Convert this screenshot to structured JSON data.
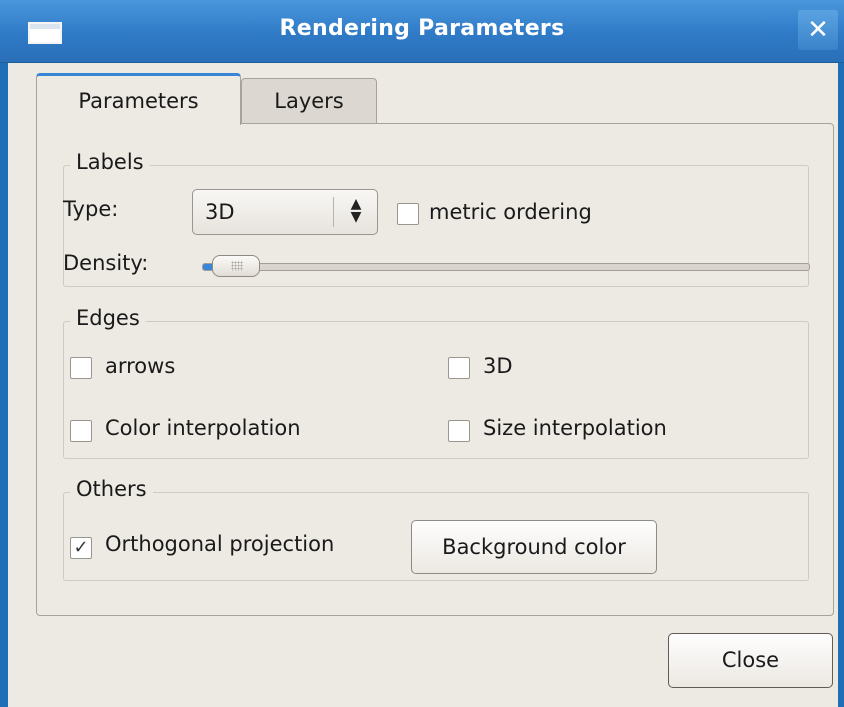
{
  "window": {
    "title": "Rendering Parameters",
    "close_glyph": "✕",
    "title_icon": "window-icon"
  },
  "tabs": [
    {
      "label": "Parameters",
      "active": true
    },
    {
      "label": "Layers",
      "active": false
    }
  ],
  "labels_section": {
    "title": "Labels",
    "type_label": "Type:",
    "type_value": "3D",
    "metric_ordering_label": "metric ordering",
    "metric_ordering_checked": false,
    "density_label": "Density:",
    "density_level": 0.02
  },
  "edges_section": {
    "title": "Edges",
    "arrows_label": "arrows",
    "arrows_checked": false,
    "edges3d_label": "3D",
    "edges3d_checked": false,
    "color_interp_label": "Color interpolation",
    "color_interp_checked": false,
    "size_interp_label": "Size interpolation",
    "size_interp_checked": false
  },
  "others_section": {
    "title": "Others",
    "ortho_label": "Orthogonal projection",
    "ortho_checked": true,
    "ortho_mark": "✓",
    "background_button": "Background color"
  },
  "footer": {
    "close_button": "Close"
  },
  "colors": {
    "titlebar": "#2f7ac6",
    "accent": "#3a86d6",
    "background": "#ede9e3"
  }
}
